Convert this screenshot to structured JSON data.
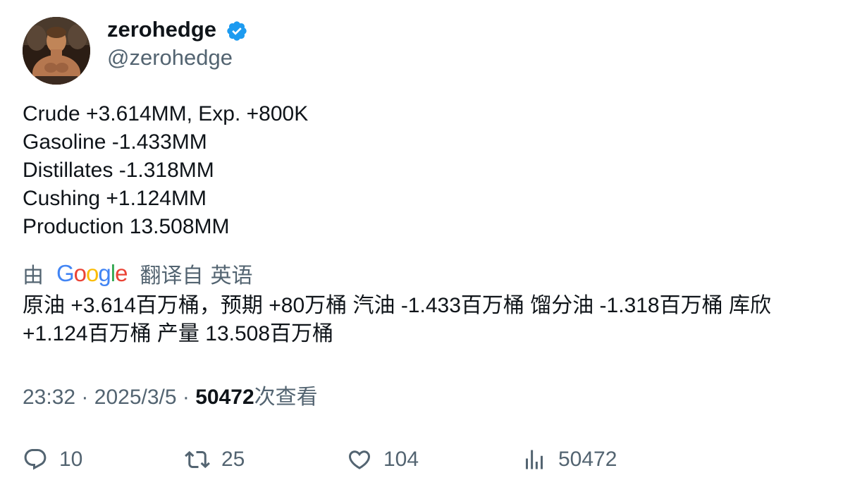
{
  "author": {
    "display_name": "zerohedge",
    "handle": "@zerohedge",
    "verified": true
  },
  "tweet_lines": [
    "Crude +3.614MM, Exp. +800K",
    "Gasoline -1.433MM",
    "Distillates -1.318MM",
    "Cushing +1.124MM",
    "Production 13.508MM"
  ],
  "translation": {
    "by_label": "由",
    "provider_letters": [
      "G",
      "o",
      "o",
      "g",
      "l",
      "e"
    ],
    "from_label": "翻译自",
    "language": "英语",
    "text": "原油 +3.614百万桶，预期 +80万桶 汽油 -1.433百万桶 馏分油 -1.318百万桶 库欣 +1.124百万桶 产量 13.508百万桶"
  },
  "meta": {
    "time": "23:32",
    "separator": "·",
    "date": "2025/3/5",
    "views_count": "50472",
    "views_label": "次查看"
  },
  "actions": {
    "replies": "10",
    "retweets": "25",
    "likes": "104",
    "views": "50472"
  },
  "colors": {
    "text_primary": "#0f1419",
    "text_secondary": "#536471",
    "verified_blue": "#1d9bf0",
    "google_blue": "#4285f4",
    "google_red": "#ea4335",
    "google_yellow": "#fbbc05",
    "google_green": "#34a853"
  },
  "icons": {
    "reply": "speech-bubble-icon",
    "retweet": "retweet-arrows-icon",
    "like": "heart-icon",
    "views": "bar-chart-icon",
    "verified": "verified-badge-icon"
  }
}
